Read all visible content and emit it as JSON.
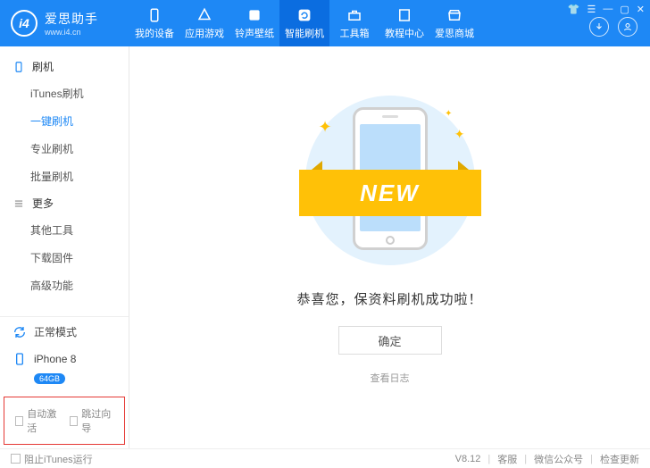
{
  "brand": {
    "name": "爱思助手",
    "url": "www.i4.cn",
    "logo_text": "i4"
  },
  "nav": [
    {
      "label": "我的设备",
      "icon": "phone"
    },
    {
      "label": "应用游戏",
      "icon": "appstore"
    },
    {
      "label": "铃声壁纸",
      "icon": "music"
    },
    {
      "label": "智能刷机",
      "icon": "refresh",
      "active": true
    },
    {
      "label": "工具箱",
      "icon": "toolbox"
    },
    {
      "label": "教程中心",
      "icon": "book"
    },
    {
      "label": "爱思商城",
      "icon": "shop"
    }
  ],
  "sidebar": {
    "group1": {
      "title": "刷机",
      "items": [
        "iTunes刷机",
        "一键刷机",
        "专业刷机",
        "批量刷机"
      ],
      "active_index": 1
    },
    "group2": {
      "title": "更多",
      "items": [
        "其他工具",
        "下载固件",
        "高级功能"
      ]
    },
    "mode": "正常模式",
    "device": {
      "name": "iPhone 8",
      "storage": "64GB"
    },
    "check_auto_activate": "自动激活",
    "check_skip_guide": "跳过向导"
  },
  "main": {
    "ribbon": "NEW",
    "message": "恭喜您，保资料刷机成功啦！",
    "ok": "确定",
    "log": "查看日志"
  },
  "footer": {
    "block_itunes": "阻止iTunes运行",
    "version": "V8.12",
    "support": "客服",
    "wechat": "微信公众号",
    "update": "检查更新"
  }
}
